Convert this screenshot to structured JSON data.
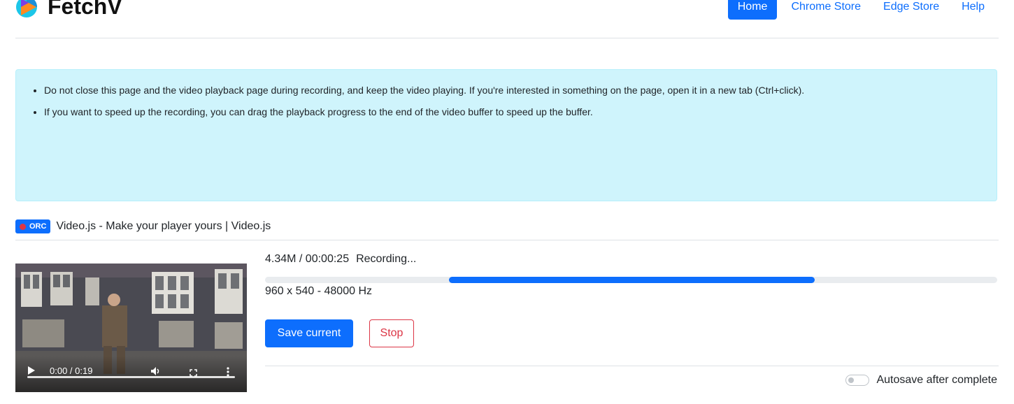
{
  "header": {
    "brand": "FetchV",
    "nav": [
      {
        "label": "Home",
        "active": true
      },
      {
        "label": "Chrome Store",
        "active": false
      },
      {
        "label": "Edge Store",
        "active": false
      },
      {
        "label": "Help",
        "active": false
      }
    ]
  },
  "notice": {
    "items": [
      "Do not close this page and the video playback page during recording, and keep the video playing. If you're interested in something on the page, open it in a new tab (Ctrl+click).",
      "If you want to speed up the recording, you can drag the playback progress to the end of the video buffer to speed up the buffer."
    ]
  },
  "recording": {
    "badge": "ORC",
    "title": "Video.js - Make your player yours | Video.js",
    "size_duration": "4.34M / 00:00:25",
    "status": "Recording...",
    "resolution": "960 x 540 - 48000 Hz",
    "buffer_range": {
      "start_fraction": 0.251,
      "end_fraction": 0.751
    },
    "player": {
      "time": "0:00 / 0:19",
      "icons": [
        "play-icon",
        "volume-icon",
        "fullscreen-icon",
        "more-options-icon"
      ]
    },
    "save_label": "Save current",
    "stop_label": "Stop",
    "autosave_label": "Autosave after complete",
    "autosave_enabled": false
  },
  "colors": {
    "primary": "#0d6efd",
    "danger": "#dc3545",
    "info_bg": "#cff4fc"
  }
}
